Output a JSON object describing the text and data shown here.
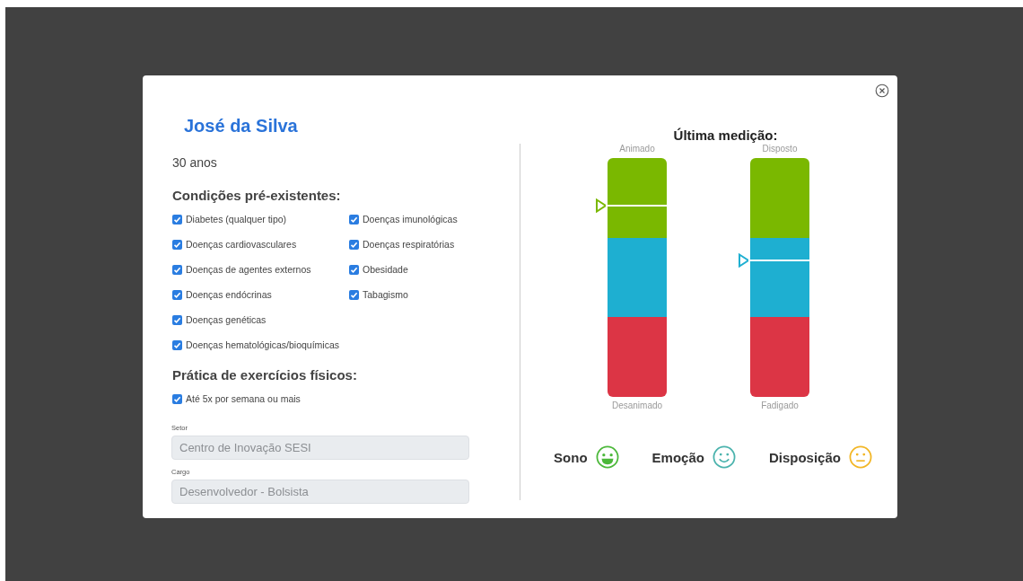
{
  "patient": {
    "name": "José da Silva",
    "age": "30 anos"
  },
  "conditions": {
    "title": "Condições pré-existentes:",
    "items": [
      {
        "label": "Diabetes (qualquer tipo)",
        "checked": true
      },
      {
        "label": "Doenças cardiovasculares",
        "checked": true
      },
      {
        "label": "Doenças de agentes externos",
        "checked": true
      },
      {
        "label": "Doenças endócrinas",
        "checked": true
      },
      {
        "label": "Doenças genéticas",
        "checked": true
      },
      {
        "label": "Doenças hematológicas/bioquímicas",
        "checked": true
      },
      {
        "label": "Doenças imunológicas",
        "checked": true
      },
      {
        "label": "Doenças respiratórias",
        "checked": true
      },
      {
        "label": "Obesidade",
        "checked": true
      },
      {
        "label": "Tabagismo",
        "checked": true
      }
    ]
  },
  "exercise": {
    "title": "Prática de exercícios físicos:",
    "items": [
      {
        "label": "Até 5x por semana ou mais",
        "checked": true
      }
    ]
  },
  "fields": [
    {
      "label": "Setor",
      "value": "Centro de Inovação SESI",
      "disabled": true
    },
    {
      "label": "Cargo",
      "value": "Desenvolvedor - Bolsista",
      "disabled": true
    }
  ],
  "measurement": {
    "title": "Última medição:",
    "gauges": [
      {
        "top_label": "Animado",
        "bottom_label": "Desanimado",
        "level": 0.8
      },
      {
        "top_label": "Disposto",
        "bottom_label": "Fadigado",
        "level": 0.57
      }
    ]
  },
  "moods": [
    {
      "label": "Sono",
      "kind": "laughing",
      "color": "#4cb83a"
    },
    {
      "label": "Emoção",
      "kind": "smiling",
      "color": "#4bb3ad"
    },
    {
      "label": "Disposição",
      "kind": "neutral",
      "color": "#f2b625"
    }
  ]
}
